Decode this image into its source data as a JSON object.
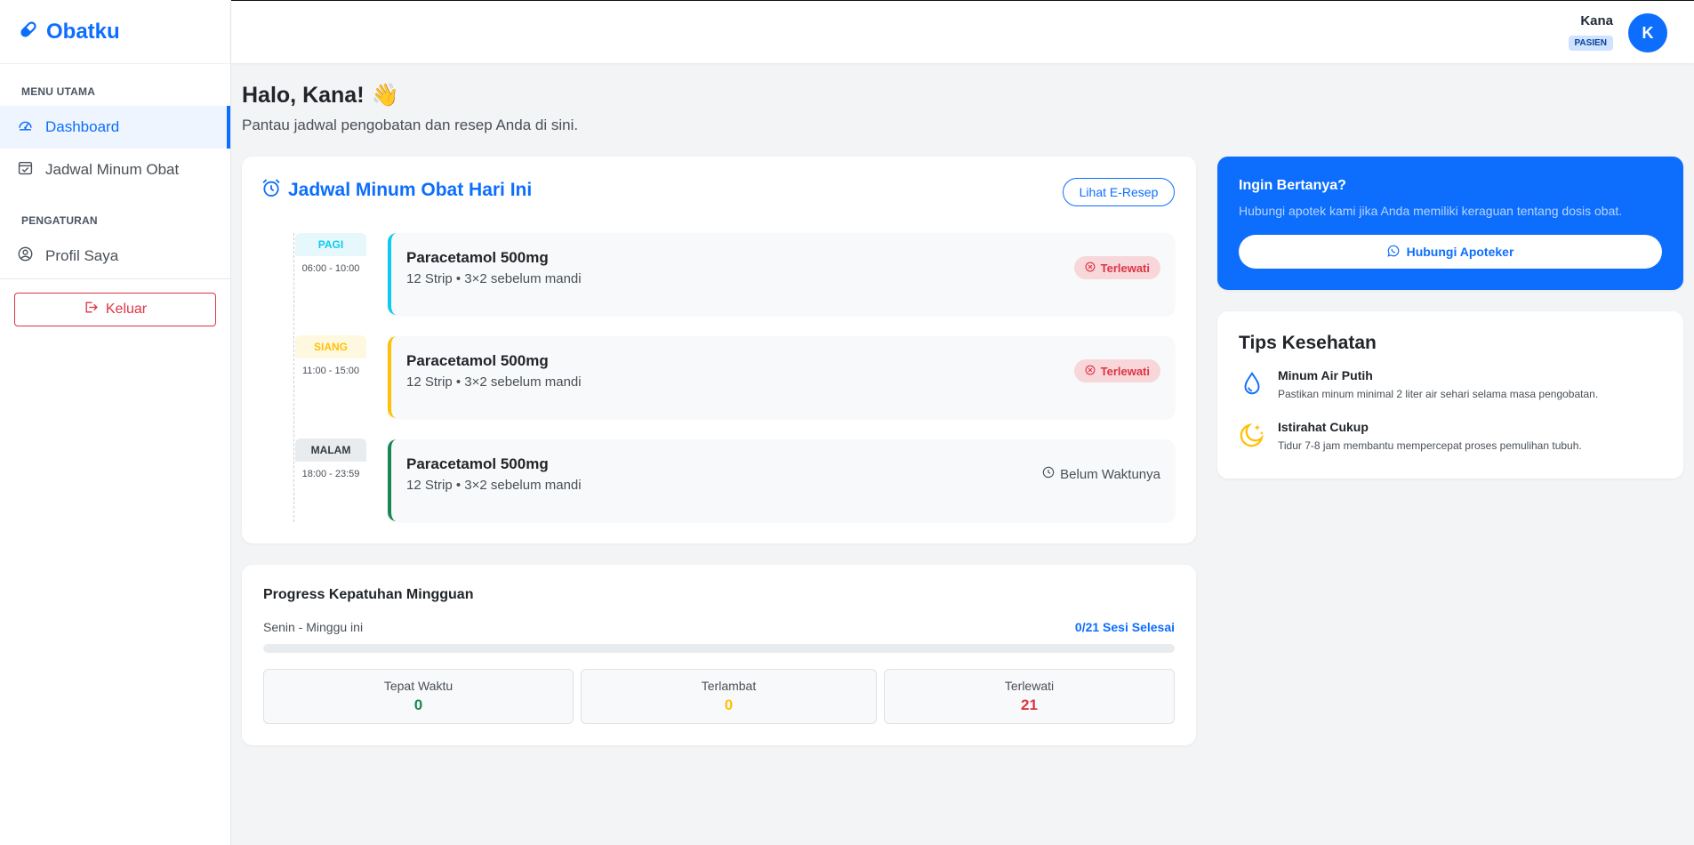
{
  "brand": {
    "name": "Obatku"
  },
  "sidebar": {
    "section_main": "MENU UTAMA",
    "section_settings": "PENGATURAN",
    "items": [
      {
        "label": "Dashboard",
        "icon": "speedometer-icon",
        "active": true
      },
      {
        "label": "Jadwal Minum Obat",
        "icon": "calendar-check-icon",
        "active": false
      },
      {
        "label": "Profil Saya",
        "icon": "person-circle-icon",
        "active": false
      }
    ],
    "logout_label": "Keluar"
  },
  "header": {
    "user_name": "Kana",
    "role": "PASIEN",
    "avatar_initial": "K"
  },
  "greeting": {
    "title": "Halo, Kana!",
    "emoji": "👋",
    "subtitle": "Pantau jadwal pengobatan dan resep Anda di sini."
  },
  "schedule": {
    "title": "Jadwal Minum Obat Hari Ini",
    "erecipe_button": "Lihat E-Resep",
    "slots": [
      {
        "label": "PAGI",
        "time": "06:00 - 10:00",
        "med": "Paracetamol 500mg",
        "detail": "12 Strip • 3×2 sebelum mandi",
        "status": "Terlewati",
        "status_type": "missed",
        "badge_bg": "#e7f8fc",
        "badge_color": "#0dcaf0",
        "accent": "#0dcaf0"
      },
      {
        "label": "SIANG",
        "time": "11:00 - 15:00",
        "med": "Paracetamol 500mg",
        "detail": "12 Strip • 3×2 sebelum mandi",
        "status": "Terlewati",
        "status_type": "missed",
        "badge_bg": "#fff8e1",
        "badge_color": "#ffc107",
        "accent": "#ffc107"
      },
      {
        "label": "MALAM",
        "time": "18:00 - 23:59",
        "med": "Paracetamol 500mg",
        "detail": "12 Strip • 3×2 sebelum mandi",
        "status": "Belum Waktunya",
        "status_type": "pending",
        "badge_bg": "#e9ecef",
        "badge_color": "#343a40",
        "accent": "#198754"
      }
    ]
  },
  "progress": {
    "title": "Progress Kepatuhan Mingguan",
    "period": "Senin - Minggu ini",
    "count_label": "0/21 Sesi Selesai",
    "fraction_complete": 0,
    "stats": [
      {
        "label": "Tepat Waktu",
        "value": "0",
        "color": "#198754"
      },
      {
        "label": "Terlambat",
        "value": "0",
        "color": "#ffc107"
      },
      {
        "label": "Terlewati",
        "value": "21",
        "color": "#dc3545"
      }
    ]
  },
  "ask": {
    "title": "Ingin Bertanya?",
    "subtitle": "Hubungi apotek kami jika Anda memiliki keraguan tentang dosis obat.",
    "button": "Hubungi Apoteker",
    "button_icon": "whatsapp-icon"
  },
  "tips": {
    "title": "Tips Kesehatan",
    "items": [
      {
        "title": "Minum Air Putih",
        "desc": "Pastikan minum minimal 2 liter air sehari selama masa pengobatan.",
        "icon": "droplet-icon"
      },
      {
        "title": "Istirahat Cukup",
        "desc": "Tidur 7-8 jam membantu mempercepat proses pemulihan tubuh.",
        "icon": "moon-stars-icon"
      }
    ]
  },
  "colors": {
    "primary": "#0d6efd",
    "danger": "#dc3545",
    "success": "#198754",
    "warning": "#ffc107",
    "info": "#0dcaf0"
  }
}
